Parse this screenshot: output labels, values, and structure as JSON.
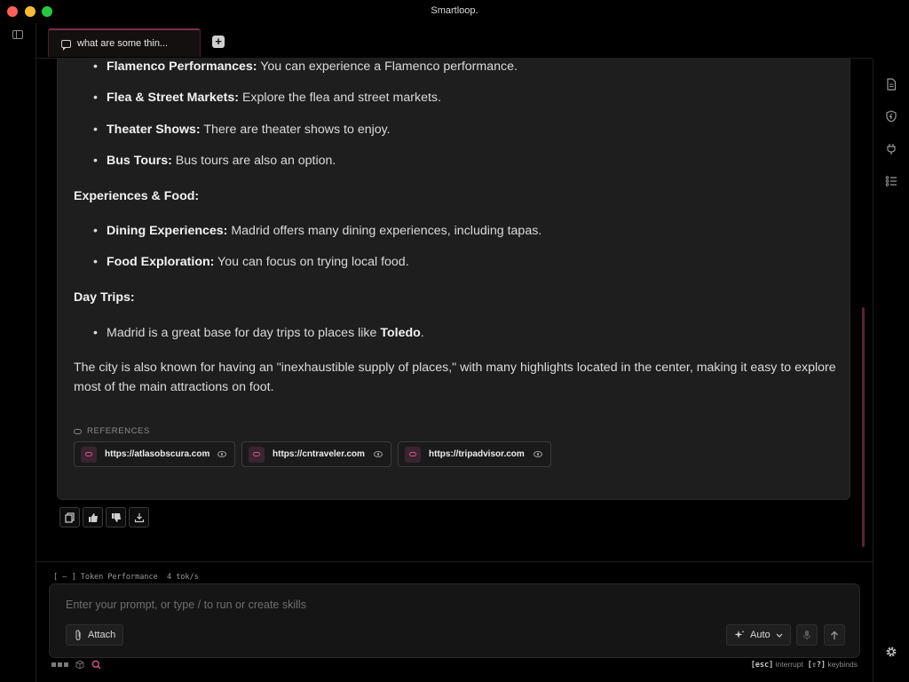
{
  "window": {
    "title": "Smartloop."
  },
  "tabs": [
    {
      "label": "what are some thin..."
    }
  ],
  "message": {
    "bullets_a": [
      {
        "bold": "Flamenco Performances:",
        "text": " You can experience a Flamenco performance."
      },
      {
        "bold": "Flea & Street Markets:",
        "text": " Explore the flea and street markets."
      },
      {
        "bold": "Theater Shows:",
        "text": " There are theater shows to enjoy."
      },
      {
        "bold": "Bus Tours:",
        "text": " Bus tours are also an option."
      }
    ],
    "heading_food": "Experiences & Food:",
    "bullets_food": [
      {
        "bold": "Dining Experiences:",
        "text": " Madrid offers many dining experiences, including tapas."
      },
      {
        "bold": "Food Exploration:",
        "text": " You can focus on trying local food."
      }
    ],
    "heading_trips": "Day Trips:",
    "trip_bullet": {
      "text": "Madrid is a great base for day trips to places like ",
      "bold": "Toledo",
      "tail": "."
    },
    "closing": "The city is also known for having an \"inexhaustible supply of places,\" with many highlights located in the center, making it easy to explore most of the main attractions on foot.",
    "references_label": "REFERENCES",
    "references": [
      {
        "url": "https://atlasobscura.com"
      },
      {
        "url": "https://cntraveler.com"
      },
      {
        "url": "https://tripadvisor.com"
      }
    ]
  },
  "token_performance": {
    "label": "[ – ]  Token Performance",
    "rate": "4 tok/s"
  },
  "composer": {
    "placeholder": "Enter your prompt, or type / to run or create skills",
    "attach_label": "Attach",
    "mode_label": "Auto"
  },
  "status_bar": {
    "interrupt_key": "[esc]",
    "interrupt_label": "interrupt",
    "keybinds_key": "[⇧?]",
    "keybinds_label": "keybinds"
  },
  "colors": {
    "accent": "#d0527f",
    "tab_border": "#7a2e4c",
    "background": "#000000",
    "card": "#1e1e1e"
  },
  "icons": {
    "right_rail": [
      "document-icon",
      "shield-bolt-icon",
      "plug-icon",
      "checklist-icon"
    ],
    "message_actions": [
      "copy-icon",
      "thumbs-up-icon",
      "thumbs-down-icon",
      "download-icon"
    ]
  }
}
